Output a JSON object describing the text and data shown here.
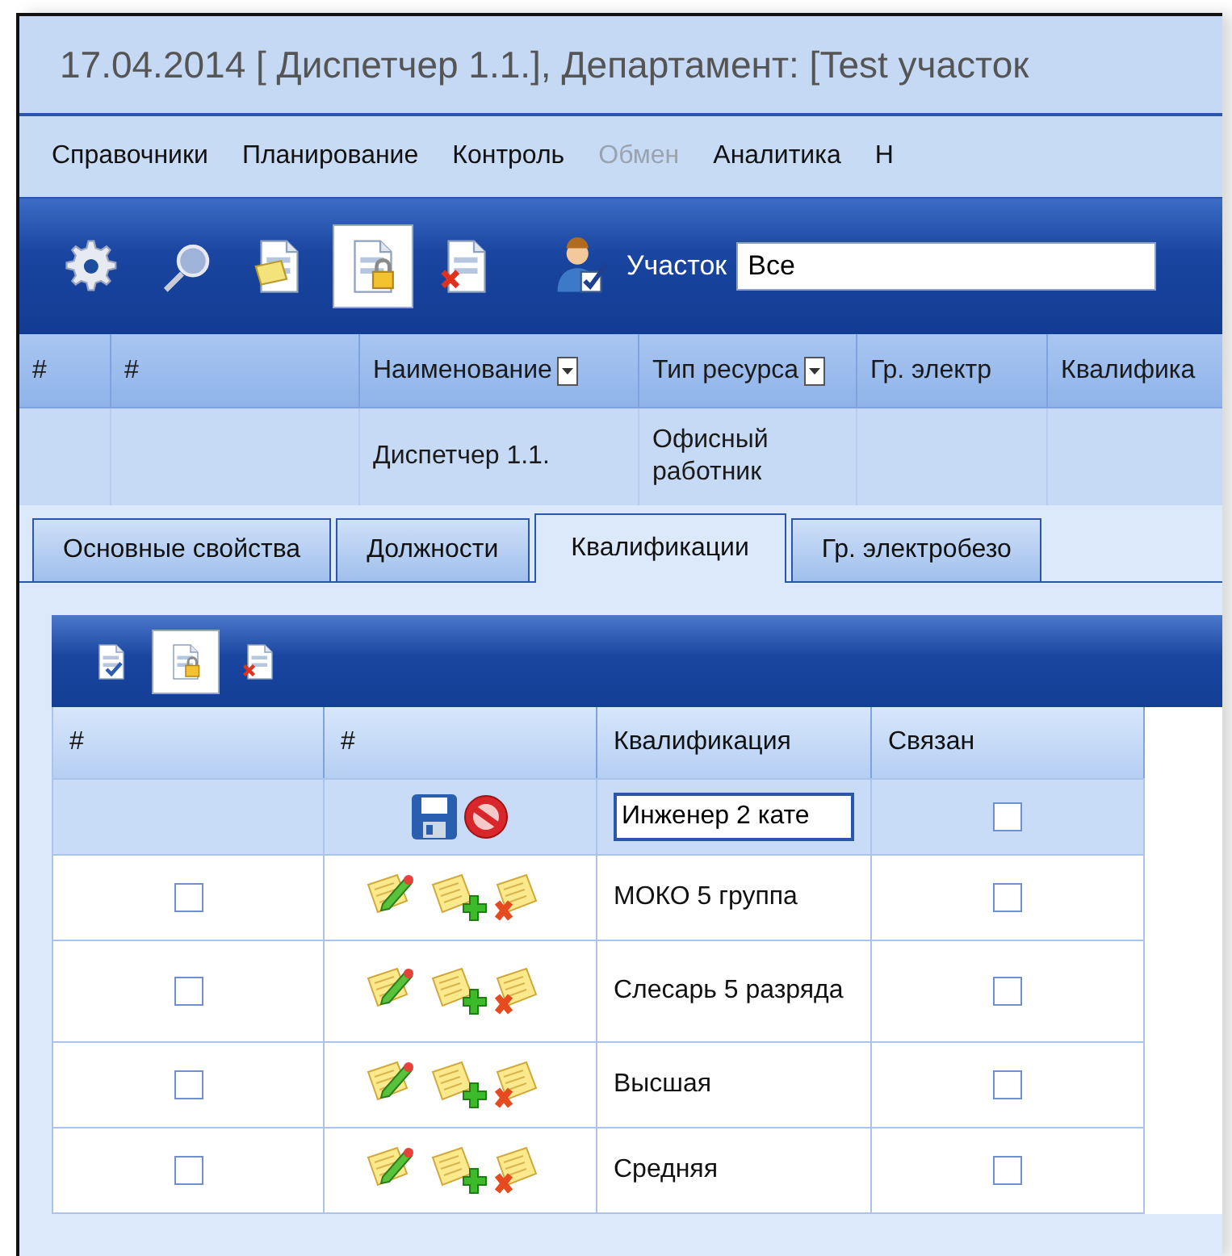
{
  "window": {
    "title": "17.04.2014 [ Диспетчер 1.1.], Департамент: [Test участок"
  },
  "menu": [
    {
      "label": "Справочники",
      "disabled": false
    },
    {
      "label": "Планирование",
      "disabled": false
    },
    {
      "label": "Контроль",
      "disabled": false
    },
    {
      "label": "Обмен",
      "disabled": true
    },
    {
      "label": "Аналитика",
      "disabled": false
    },
    {
      "label": "Н",
      "disabled": false
    }
  ],
  "toolbar": {
    "buttons": [
      {
        "kind": "gear",
        "pressed": false
      },
      {
        "kind": "search",
        "pressed": false
      },
      {
        "kind": "note",
        "pressed": false
      },
      {
        "kind": "lock",
        "pressed": true
      },
      {
        "kind": "delete",
        "pressed": false
      },
      {
        "kind": "user",
        "pressed": false
      }
    ],
    "filter": {
      "label": "Участок",
      "value": "Все"
    }
  },
  "grid": {
    "columns": [
      {
        "label": "#",
        "filter": false
      },
      {
        "label": "#",
        "filter": false
      },
      {
        "label": "Наименование",
        "filter": true
      },
      {
        "label": "Тип ресурса",
        "filter": true
      },
      {
        "label": "Гр. электр",
        "filter": false
      },
      {
        "label": "Квалифика",
        "filter": false
      }
    ],
    "rows": [
      {
        "name": "Диспетчер 1.1.",
        "resource_type": "Офисный работник"
      }
    ]
  },
  "tabs": [
    {
      "label": "Основные свойства",
      "selected": false
    },
    {
      "label": "Должности",
      "selected": false
    },
    {
      "label": "Квалификации",
      "selected": true
    },
    {
      "label": "Гр. электробезо",
      "selected": false
    }
  ],
  "qualifications": {
    "toolbar": [
      {
        "kind": "check",
        "pressed": false
      },
      {
        "kind": "lock",
        "pressed": true
      },
      {
        "kind": "delete",
        "pressed": false
      }
    ],
    "columns": [
      "#",
      "#",
      "Квалификация",
      "Связан"
    ],
    "edit_row": {
      "value": "Инженер 2 кате",
      "linked": false
    },
    "rows": [
      {
        "checked": false,
        "name": "МОКО 5 группа",
        "linked": false
      },
      {
        "checked": false,
        "name": "Слесарь 5 разряда",
        "linked": false
      },
      {
        "checked": false,
        "name": "Высшая",
        "linked": false
      },
      {
        "checked": false,
        "name": "Средняя",
        "linked": false
      }
    ]
  }
}
